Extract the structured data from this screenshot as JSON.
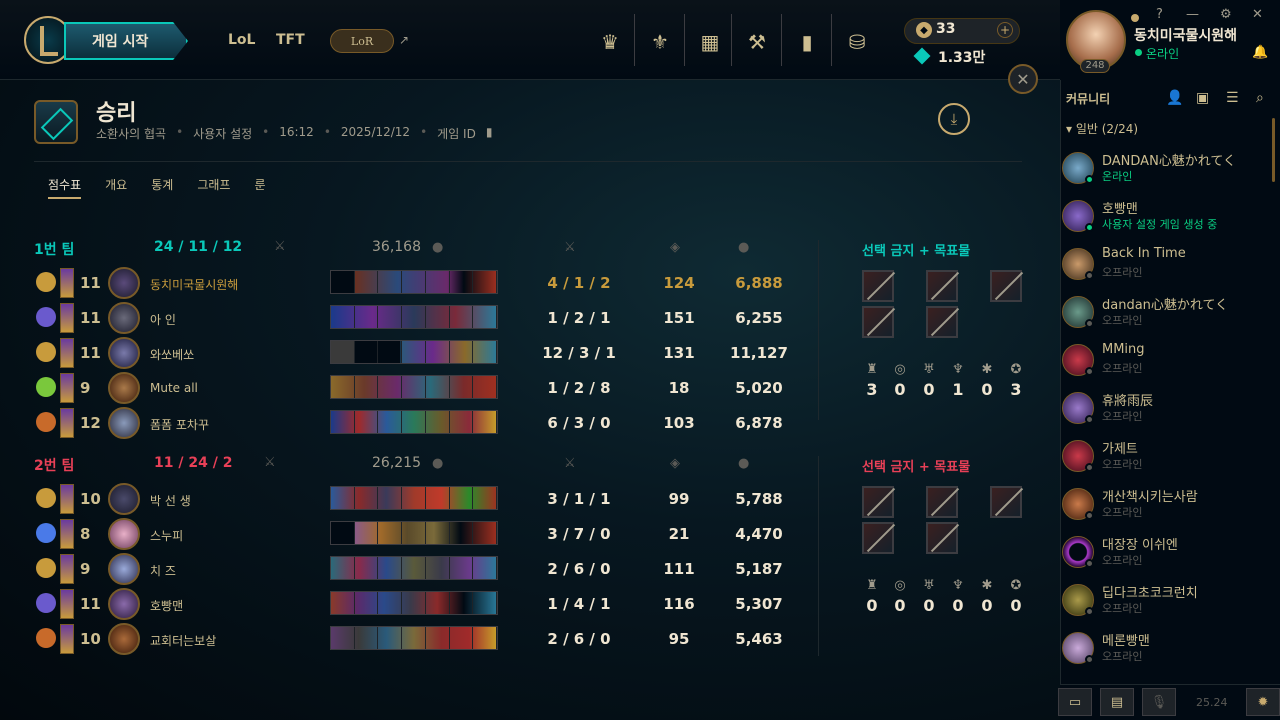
{
  "header": {
    "play_label": "게임 시작",
    "nav_lol": "LoL",
    "nav_tft": "TFT",
    "nav_lor": "LoR",
    "ext_link": "↗",
    "rp": "33",
    "be": "1.33만",
    "rp_add": "+"
  },
  "profile": {
    "name": "동치미국물시원해",
    "status": "온라인",
    "level": "248",
    "help": "?",
    "minimize": "—",
    "settings": "⚙",
    "close": "✕"
  },
  "match": {
    "title": "승리",
    "mode": "소환사의 협곡",
    "type": "사용자 설정",
    "duration": "16:12",
    "date": "2025/12/12",
    "game_id_label": "게임 ID",
    "tabs": [
      "점수표",
      "개요",
      "통계",
      "그래프",
      "룬"
    ]
  },
  "teams": [
    {
      "name": "1번 팀",
      "kda": "24  /  11  /  12",
      "gold": "36,168",
      "bans_title": "선택 금지 + 목표물",
      "objectives": [
        "3",
        "0",
        "0",
        "1",
        "0",
        "3"
      ],
      "players": [
        {
          "level": "11",
          "name": "동치미국물시원해",
          "kda": "4  /  1  /  2",
          "cs": "124",
          "gold": "6,888",
          "me": true
        },
        {
          "level": "11",
          "name": "아 인",
          "kda": "1  /  2  /  1",
          "cs": "151",
          "gold": "6,255"
        },
        {
          "level": "11",
          "name": "와쏘베쏘",
          "kda": "12  /  3  /  1",
          "cs": "131",
          "gold": "11,127"
        },
        {
          "level": "9",
          "name": "Mute all",
          "kda": "1  /  2  /  8",
          "cs": "18",
          "gold": "5,020"
        },
        {
          "level": "12",
          "name": "폼폼 포차꾸",
          "kda": "6  /  3  /  0",
          "cs": "103",
          "gold": "6,878"
        }
      ]
    },
    {
      "name": "2번 팀",
      "kda": "11  /  24  /  2",
      "gold": "26,215",
      "bans_title": "선택 금지 + 목표물",
      "objectives": [
        "0",
        "0",
        "0",
        "0",
        "0",
        "0"
      ],
      "players": [
        {
          "level": "10",
          "name": "박 선 생",
          "kda": "3  /  1  /  1",
          "cs": "99",
          "gold": "5,788"
        },
        {
          "level": "8",
          "name": "스누피",
          "kda": "3  /  7  /  0",
          "cs": "21",
          "gold": "4,470"
        },
        {
          "level": "9",
          "name": "치 즈",
          "kda": "2  /  6  /  0",
          "cs": "111",
          "gold": "5,187"
        },
        {
          "level": "11",
          "name": "호빵맨",
          "kda": "1  /  4  /  1",
          "cs": "116",
          "gold": "5,307"
        },
        {
          "level": "10",
          "name": "교회터는보살",
          "kda": "2  /  6  /  0",
          "cs": "95",
          "gold": "5,463"
        }
      ]
    }
  ],
  "social": {
    "title": "커뮤니티",
    "group": "일반 (2/24)",
    "friends": [
      {
        "name": "DANDAN心魅かれてく",
        "status": "온라인",
        "online": true
      },
      {
        "name": "호빵맨",
        "status": "사용자 설정 게임 생성 중",
        "online": true
      },
      {
        "name": "Back In Time",
        "status": "오프라인"
      },
      {
        "name": "dandan心魅かれてく",
        "status": "오프라인"
      },
      {
        "name": "MMing",
        "status": "오프라인"
      },
      {
        "name": "휴將雨辰",
        "status": "오프라인"
      },
      {
        "name": "가제트",
        "status": "오프라인"
      },
      {
        "name": "개산책시키는사람",
        "status": "오프라인"
      },
      {
        "name": "대장장 이쉬엔",
        "status": "오프라인"
      },
      {
        "name": "딥다크초코크런치",
        "status": "오프라인"
      },
      {
        "name": "메론빵맨",
        "status": "오프라인"
      }
    ],
    "version": "25.24"
  }
}
